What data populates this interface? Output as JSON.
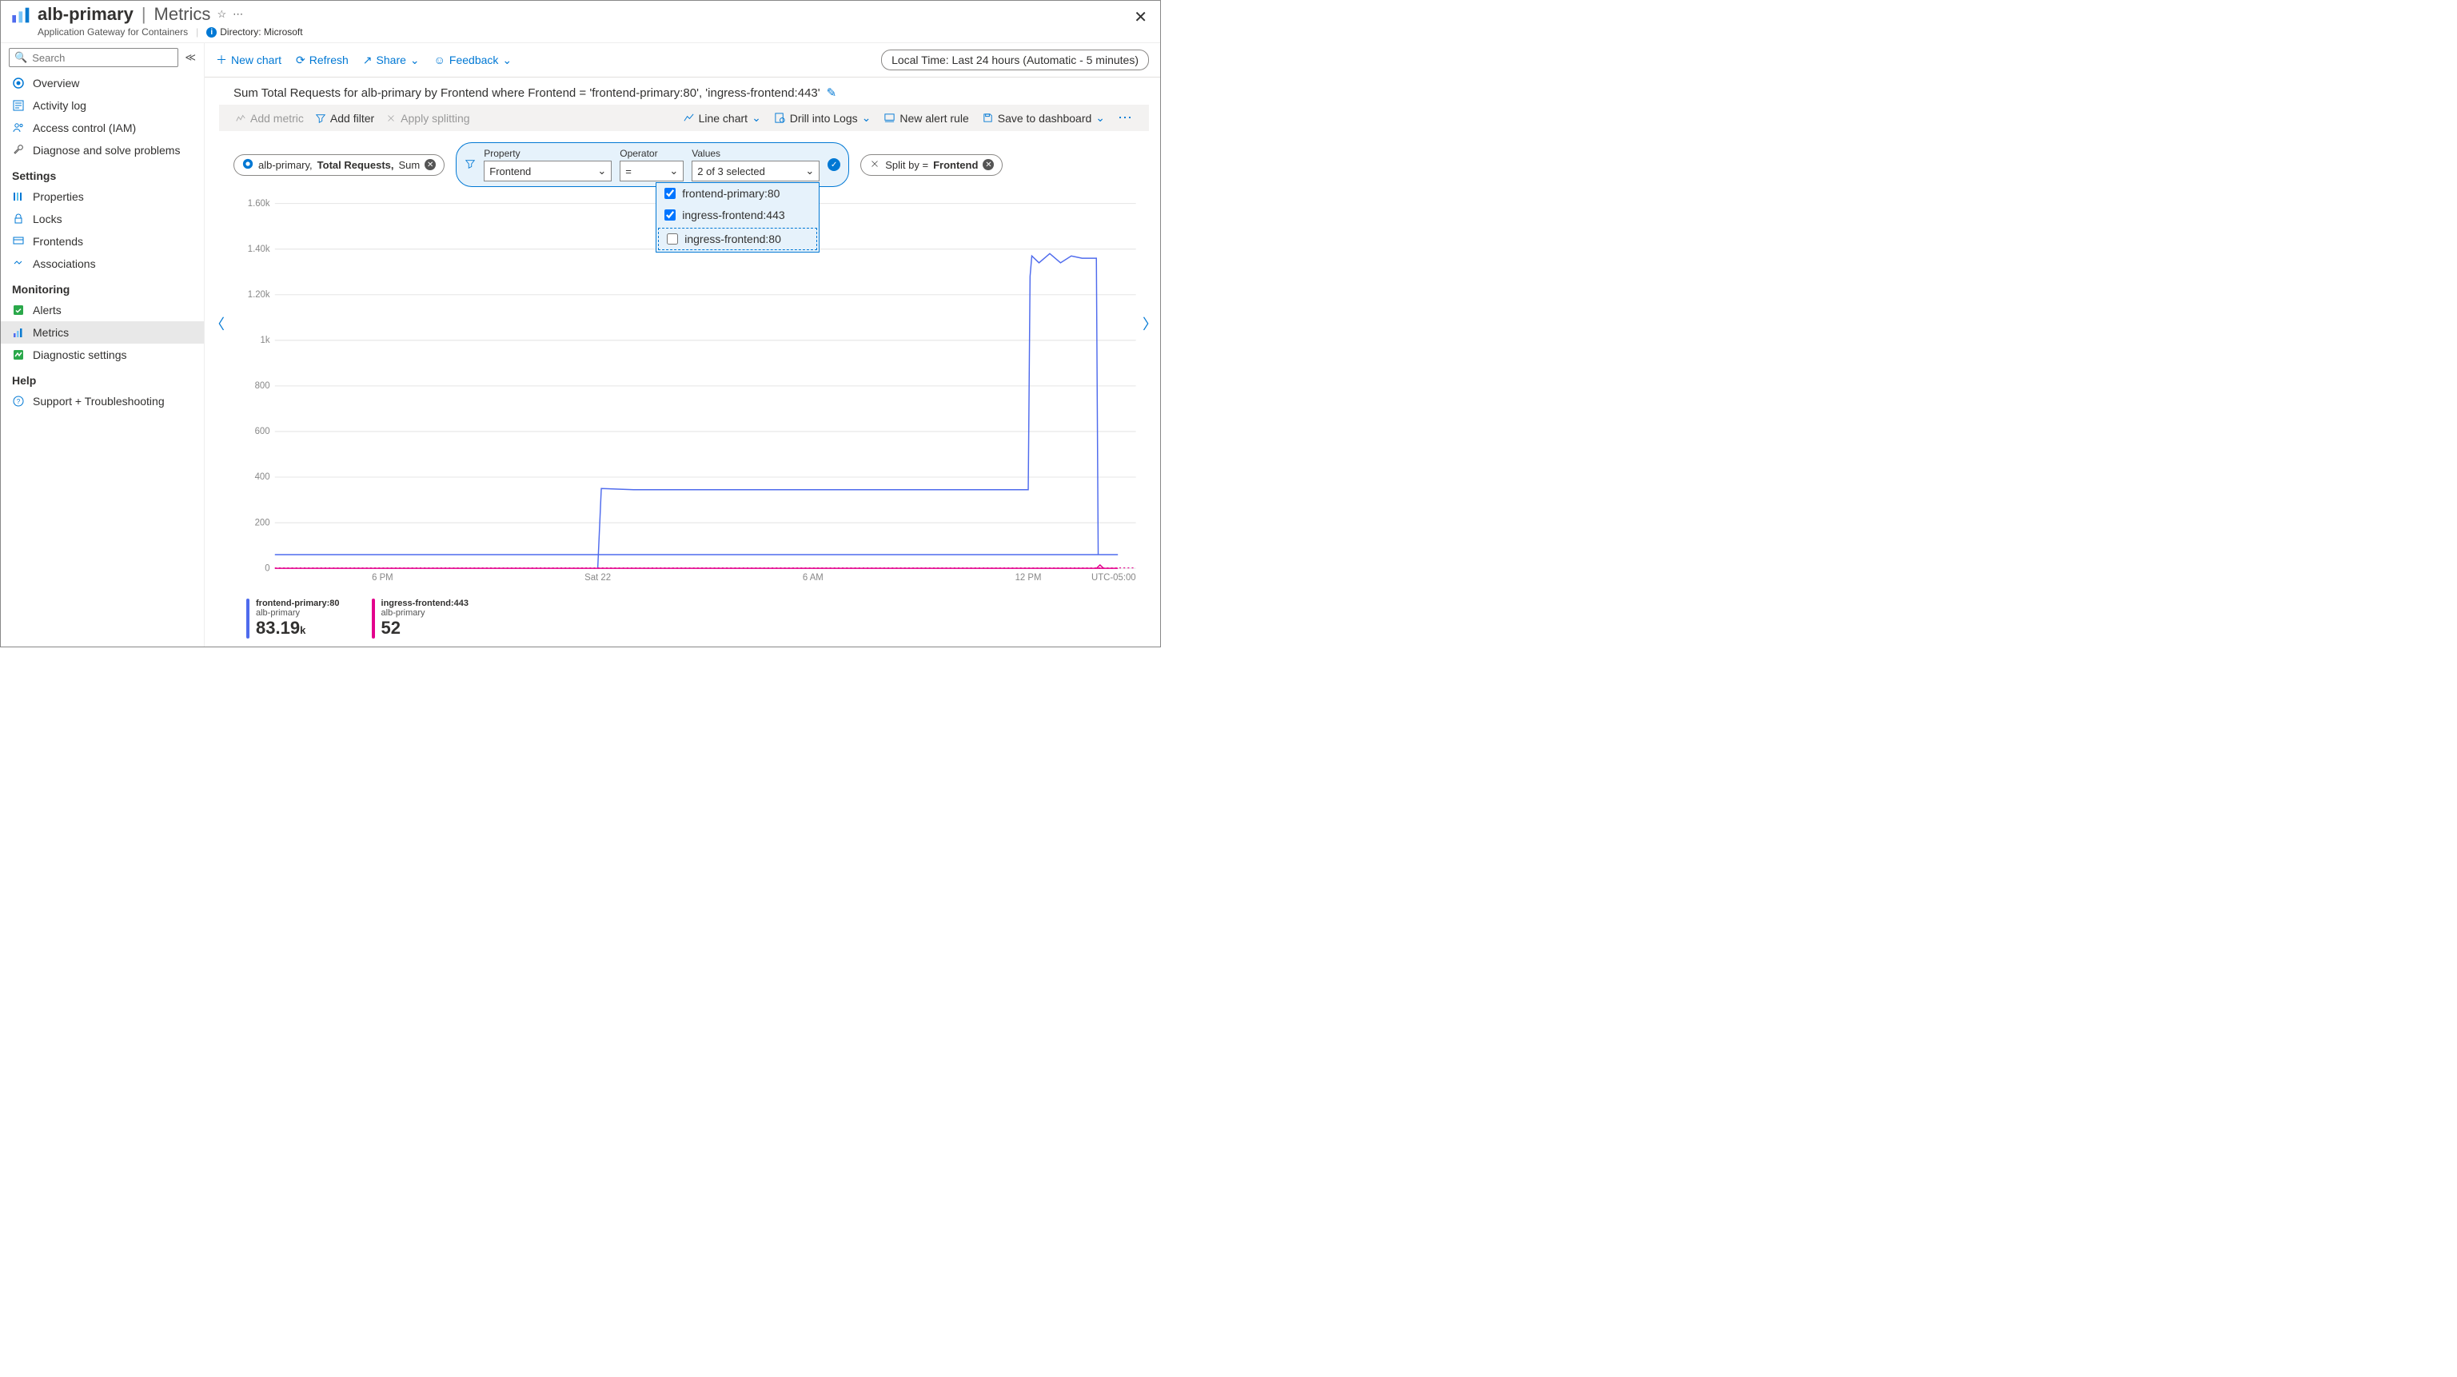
{
  "header": {
    "resource": "alb-primary",
    "title_suffix": "Metrics",
    "subtitle": "Application Gateway for Containers",
    "directory_label": "Directory: Microsoft"
  },
  "sidebar": {
    "search_placeholder": "Search",
    "overview": "Overview",
    "activity": "Activity log",
    "iam": "Access control (IAM)",
    "diagnose": "Diagnose and solve problems",
    "settings_section": "Settings",
    "properties": "Properties",
    "locks": "Locks",
    "frontends": "Frontends",
    "associations": "Associations",
    "monitoring_section": "Monitoring",
    "alerts": "Alerts",
    "metrics": "Metrics",
    "diag_settings": "Diagnostic settings",
    "help_section": "Help",
    "support": "Support + Troubleshooting"
  },
  "toolbar": {
    "new_chart": "New chart",
    "refresh": "Refresh",
    "share": "Share",
    "feedback": "Feedback",
    "time_badge": "Local Time: Last 24 hours (Automatic - 5 minutes)"
  },
  "chart_header": "Sum Total Requests for alb-primary by Frontend where Frontend = 'frontend-primary:80', 'ingress-frontend:443'",
  "chips_bar": {
    "add_metric": "Add metric",
    "add_filter": "Add filter",
    "apply_split": "Apply splitting",
    "line_chart": "Line chart",
    "drill_logs": "Drill into Logs",
    "new_alert": "New alert rule",
    "save_dashboard": "Save to dashboard"
  },
  "metric_pill": {
    "resource": "alb-primary, ",
    "metric": "Total Requests, ",
    "agg": "Sum"
  },
  "filter_panel": {
    "property_label": "Property",
    "property_value": "Frontend",
    "operator_label": "Operator",
    "operator_value": "=",
    "values_label": "Values",
    "values_summary": "2 of 3 selected",
    "options": [
      {
        "label": "frontend-primary:80",
        "checked": true
      },
      {
        "label": "ingress-frontend:443",
        "checked": true
      },
      {
        "label": "ingress-frontend:80",
        "checked": false
      }
    ]
  },
  "split_pill": {
    "text": "Split by = ",
    "value": "Frontend"
  },
  "legend": [
    {
      "title": "frontend-primary:80",
      "sub": "alb-primary",
      "value": "83.19",
      "unit": "k"
    },
    {
      "title": "ingress-frontend:443",
      "sub": "alb-primary",
      "value": "52",
      "unit": ""
    }
  ],
  "chart_data": {
    "type": "line",
    "ylim": [
      0,
      1600
    ],
    "y_ticks": [
      "0",
      "200",
      "400",
      "600",
      "800",
      "1k",
      "1.20k",
      "1.40k",
      "1.60k"
    ],
    "x_ticks": [
      "6 PM",
      "Sat 22",
      "6 AM",
      "12 PM"
    ],
    "x_right_label": "UTC-05:00",
    "x_timeline_hours": [
      "15",
      "16",
      "17",
      "18",
      "19",
      "20",
      "21",
      "22",
      "23",
      "0",
      "1",
      "2",
      "3",
      "4",
      "5",
      "6",
      "7",
      "8",
      "9",
      "10",
      "11",
      "12",
      "13",
      "14",
      "15"
    ],
    "series": [
      {
        "name": "frontend-primary:80",
        "color": "#4f6bed",
        "data": [
          [
            15,
            null
          ],
          [
            16,
            null
          ],
          [
            17,
            null
          ],
          [
            18,
            null
          ],
          [
            19,
            null
          ],
          [
            20,
            null
          ],
          [
            21,
            null
          ],
          [
            22,
            null
          ],
          [
            23,
            null
          ],
          [
            0,
            0
          ],
          [
            0.1,
            350
          ],
          [
            1,
            345
          ],
          [
            2,
            345
          ],
          [
            3,
            345
          ],
          [
            4,
            345
          ],
          [
            5,
            345
          ],
          [
            6,
            345
          ],
          [
            7,
            345
          ],
          [
            8,
            345
          ],
          [
            9,
            345
          ],
          [
            10,
            345
          ],
          [
            11,
            345
          ],
          [
            12,
            345
          ],
          [
            12.05,
            1280
          ],
          [
            12.1,
            1370
          ],
          [
            12.3,
            1340
          ],
          [
            12.6,
            1380
          ],
          [
            12.9,
            1340
          ],
          [
            13.2,
            1370
          ],
          [
            13.5,
            1360
          ],
          [
            13.9,
            1360
          ],
          [
            13.95,
            60
          ],
          [
            14.5,
            60
          ],
          [
            15,
            60
          ]
        ]
      },
      {
        "name": "ingress-frontend:443",
        "color": "#e3008c",
        "data": [
          [
            15,
            0
          ],
          [
            16,
            0
          ],
          [
            17,
            0
          ],
          [
            18,
            0
          ],
          [
            19,
            0
          ],
          [
            20,
            0
          ],
          [
            21,
            0
          ],
          [
            22,
            0
          ],
          [
            23,
            0
          ],
          [
            0,
            0
          ],
          [
            1,
            0
          ],
          [
            2,
            0
          ],
          [
            3,
            0
          ],
          [
            4,
            0
          ],
          [
            5,
            0
          ],
          [
            6,
            0
          ],
          [
            7,
            0
          ],
          [
            8,
            0
          ],
          [
            9,
            0
          ],
          [
            10,
            0
          ],
          [
            11,
            0
          ],
          [
            12,
            0
          ],
          [
            13,
            0
          ],
          [
            13.9,
            0
          ],
          [
            14.0,
            15
          ],
          [
            14.1,
            0
          ],
          [
            14.5,
            0
          ],
          [
            15,
            0
          ]
        ]
      }
    ]
  }
}
